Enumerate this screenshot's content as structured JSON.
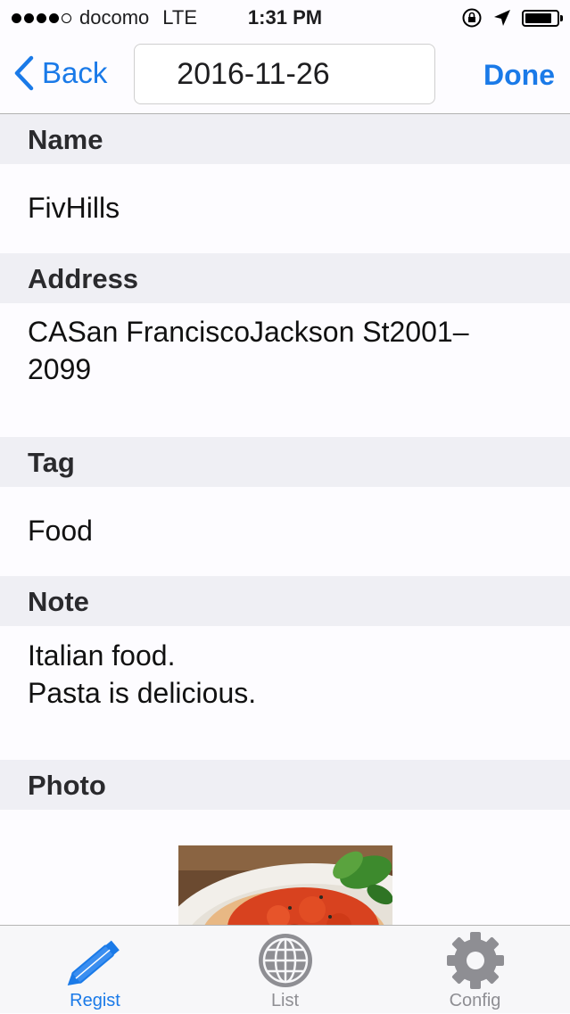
{
  "status_bar": {
    "carrier": "docomo",
    "network": "LTE",
    "time": "1:31 PM",
    "signal_bars_filled": 4,
    "signal_bars_total": 5,
    "battery_level": 0.85
  },
  "nav": {
    "back_label": "Back",
    "date_value": "2016-11-26",
    "done_label": "Done",
    "accent_color": "#1a7ae8"
  },
  "sections": {
    "name": {
      "title": "Name",
      "value": "FivHills"
    },
    "address": {
      "title": "Address",
      "value_line1": "CASan FranciscoJackson St2001–",
      "value_line2": "2099"
    },
    "tag": {
      "title": "Tag",
      "value": "Food"
    },
    "note": {
      "title": "Note",
      "value_line1": "Italian food.",
      "value_line2": "Pasta is delicious."
    },
    "photo": {
      "title": "Photo"
    }
  },
  "tabs": [
    {
      "label": "Regist",
      "icon": "pencil-icon",
      "selected": true
    },
    {
      "label": "List",
      "icon": "globe-icon",
      "selected": false
    },
    {
      "label": "Config",
      "icon": "gear-icon",
      "selected": false
    }
  ],
  "colors": {
    "tab_selected": "#1a7ae8",
    "tab_unselected": "#8e8e93",
    "section_header_bg": "#efeff4"
  }
}
